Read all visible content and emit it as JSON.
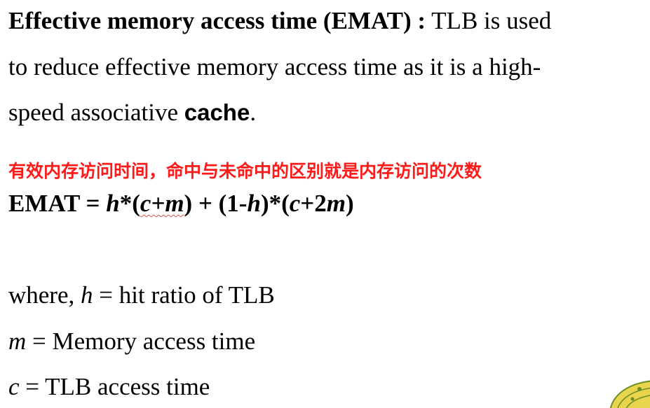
{
  "intro": {
    "heading": "Effective memory access time (EMAT) :",
    "line1_rest": " TLB is used",
    "line2": "to reduce effective memory access time as it is a high-",
    "line3_start": "speed associative ",
    "line3_cache": "cache",
    "line3_end": "."
  },
  "note_cn": "有效内存访问时间，命中与未命中的区别就是内存访问的次数",
  "formula": {
    "lhs": "EMAT = ",
    "h1": "h",
    "op1": "*(",
    "cm": "c+m",
    "mid": ") + (1-",
    "h2": "h",
    "op2": ")*(",
    "c2": "c",
    "plus2": "+2",
    "m2": "m",
    "end": ")"
  },
  "definitions": {
    "where_prefix": "where, ",
    "h_var": "h",
    "h_def": " = hit ratio of TLB",
    "m_var": "m",
    "m_def": " = Memory access time",
    "c_var": "c",
    "c_def": " = TLB access time"
  },
  "colors": {
    "note": "#ff1a1a",
    "text": "#000000",
    "decor_fill": "#e8d44d",
    "decor_stroke": "#6b8e23"
  }
}
